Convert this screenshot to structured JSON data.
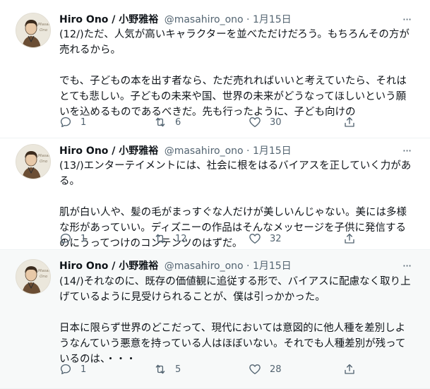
{
  "tweets": [
    {
      "name": "Hiro Ono / 小野雅裕",
      "handle": "@masahiro_ono",
      "dot": "·",
      "date": "1月15日",
      "more": "···",
      "text": "(12/)ただ、人気が高いキャラクターを並べただけだろう。もちろんその方が売れるから。\n\nでも、子どもの本を出す者なら、ただ売れればいいと考えていたら、それはとても悲しい。子どもの未来や国、世界の未来がどうなってほしいという願いを込めるものであるべきだ。先も行ったように、子ども向けの",
      "replies": "1",
      "retweets": "6",
      "likes": "30"
    },
    {
      "name": "Hiro Ono / 小野雅裕",
      "handle": "@masahiro_ono",
      "dot": "·",
      "date": "1月15日",
      "more": "···",
      "text": "(13/)エンターテイメントには、社会に根をはるバイアスを正していく力がある。\n\n肌が白い人や、髪の毛がまっすぐな人だけが美しいんじゃない。美には多様な形があっていい。ディズニーの作品はそんなメッセージを子供に発信するのにうってつけのコンテンツのはずだ。",
      "replies": "1",
      "retweets": "12",
      "likes": "32"
    },
    {
      "name": "Hiro Ono / 小野雅裕",
      "handle": "@masahiro_ono",
      "dot": "·",
      "date": "1月15日",
      "more": "···",
      "text": "(14/)それなのに、既存の価値観に追従する形で、バイアスに配慮なく取り上げているように見受けられることが、僕は引っかかった。\n\n日本に限らず世界のどこだって、現代においては意図的に他人種を差別しようなんていう悪意を持っている人はほぼいない。それでも人種差別が残っているのは、・・・",
      "replies": "1",
      "retweets": "5",
      "likes": "28"
    }
  ],
  "icons": {
    "reply": "reply-icon",
    "retweet": "retweet-icon",
    "like": "heart-icon",
    "share": "share-icon",
    "more": "more-icon"
  },
  "colors": {
    "text": "#0f1419",
    "secondary": "#536471",
    "divider": "#eff3f4",
    "highlight_bg": "#f7f9f9"
  }
}
